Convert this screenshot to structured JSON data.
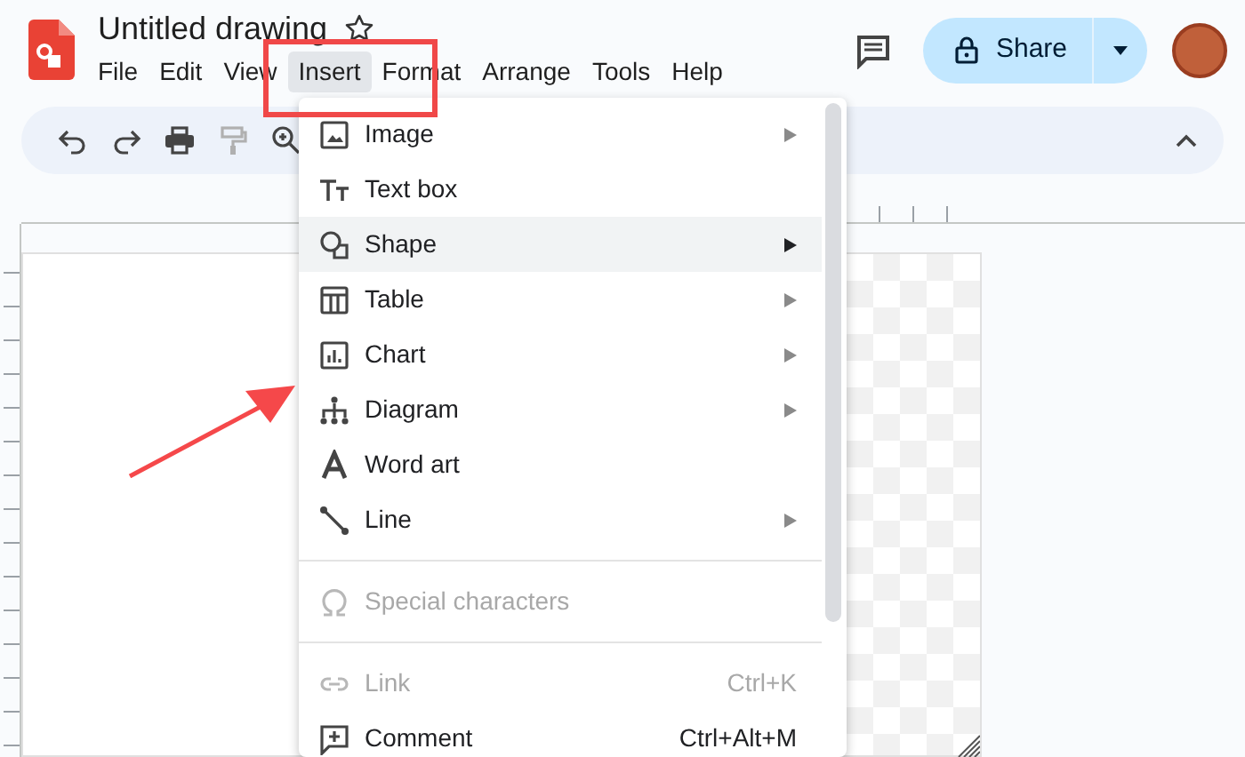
{
  "document": {
    "title": "Untitled drawing",
    "starred": false
  },
  "menu_bar": [
    {
      "label": "File",
      "selected": false
    },
    {
      "label": "Edit",
      "selected": false
    },
    {
      "label": "View",
      "selected": false
    },
    {
      "label": "Insert",
      "selected": true
    },
    {
      "label": "Format",
      "selected": false
    },
    {
      "label": "Arrange",
      "selected": false
    },
    {
      "label": "Tools",
      "selected": false
    },
    {
      "label": "Help",
      "selected": false
    }
  ],
  "share_button": {
    "label": "Share"
  },
  "insert_menu": {
    "groups": [
      [
        {
          "label": "Image",
          "submenu": true,
          "selected": false,
          "disabled": false
        },
        {
          "label": "Text box",
          "submenu": false,
          "selected": false,
          "disabled": false
        },
        {
          "label": "Shape",
          "submenu": true,
          "selected": true,
          "disabled": false
        },
        {
          "label": "Table",
          "submenu": true,
          "selected": false,
          "disabled": false
        },
        {
          "label": "Chart",
          "submenu": true,
          "selected": false,
          "disabled": false
        },
        {
          "label": "Diagram",
          "submenu": true,
          "selected": false,
          "disabled": false
        },
        {
          "label": "Word art",
          "submenu": false,
          "selected": false,
          "disabled": false
        },
        {
          "label": "Line",
          "submenu": true,
          "selected": false,
          "disabled": false
        }
      ],
      [
        {
          "label": "Special characters",
          "submenu": false,
          "selected": false,
          "disabled": true
        }
      ],
      [
        {
          "label": "Link",
          "shortcut": "Ctrl+K",
          "submenu": false,
          "selected": false,
          "disabled": true
        },
        {
          "label": "Comment",
          "shortcut": "Ctrl+Alt+M",
          "submenu": false,
          "selected": false,
          "disabled": false
        }
      ]
    ]
  }
}
